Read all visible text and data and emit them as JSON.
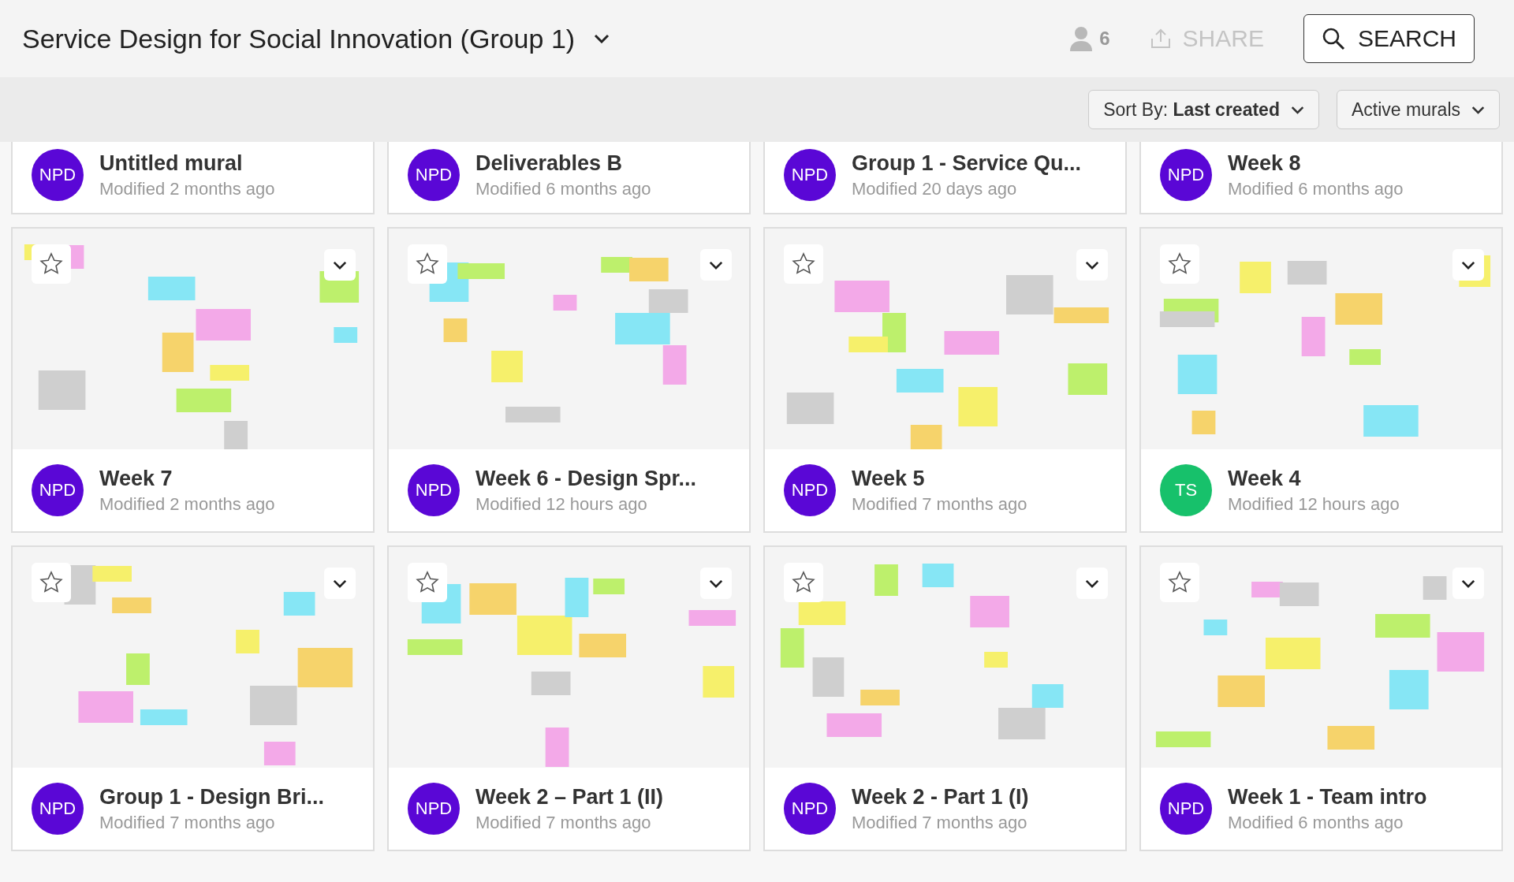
{
  "header": {
    "title": "Service Design for Social Innovation (Group 1)",
    "members": {
      "count": "6"
    },
    "share": {
      "label": "SHARE",
      "disabled": true
    },
    "search": {
      "label": "SEARCH"
    }
  },
  "toolbar": {
    "sort": "Sort By: **Last created**",
    "filter": "Active murals"
  },
  "partial_cards": [
    {
      "title": "Untitled mural",
      "owner": "NPD",
      "color": "#5a07d6",
      "modified": "Modified 2 months ago"
    },
    {
      "title": "Deliverables B",
      "owner": "NPD",
      "color": "#5a07d6",
      "modified": "Modified 6 months ago"
    },
    {
      "title": "Group 1 - Service Qu...",
      "owner": "NPD",
      "color": "#5a07d6",
      "modified": "Modified 20 days ago"
    },
    {
      "title": "Week 8",
      "owner": "NPD",
      "color": "#5a07d6",
      "modified": "Modified 6 months ago"
    }
  ],
  "cards": [
    {
      "title": "Week 7",
      "owner": "NPD",
      "color": "#5a07d6",
      "modified": "Modified 2 months ago",
      "starred": false
    },
    {
      "title": "Week 6 - Design Spr...",
      "owner": "NPD",
      "color": "#5a07d6",
      "modified": "Modified 12 hours ago",
      "starred": false
    },
    {
      "title": "Week 5",
      "owner": "NPD",
      "color": "#5a07d6",
      "modified": "Modified 7 months ago",
      "starred": false
    },
    {
      "title": "Week 4",
      "owner": "TS",
      "color": "#17c16b",
      "modified": "Modified 12 hours ago",
      "starred": false
    },
    {
      "title": "Group 1 - Design Bri...",
      "owner": "NPD",
      "color": "#5a07d6",
      "modified": "Modified 7 months ago",
      "starred": false
    },
    {
      "title": "Week 2 – Part 1 (II)",
      "owner": "NPD",
      "color": "#5a07d6",
      "modified": "Modified 7 months ago",
      "starred": false
    },
    {
      "title": "Week 2 - Part 1 (I)",
      "owner": "NPD",
      "color": "#5a07d6",
      "modified": "Modified 7 months ago",
      "starred": false
    },
    {
      "title": "Week 1 - Team intro",
      "owner": "NPD",
      "color": "#5a07d6",
      "modified": "Modified 6 months ago",
      "starred": false
    }
  ]
}
